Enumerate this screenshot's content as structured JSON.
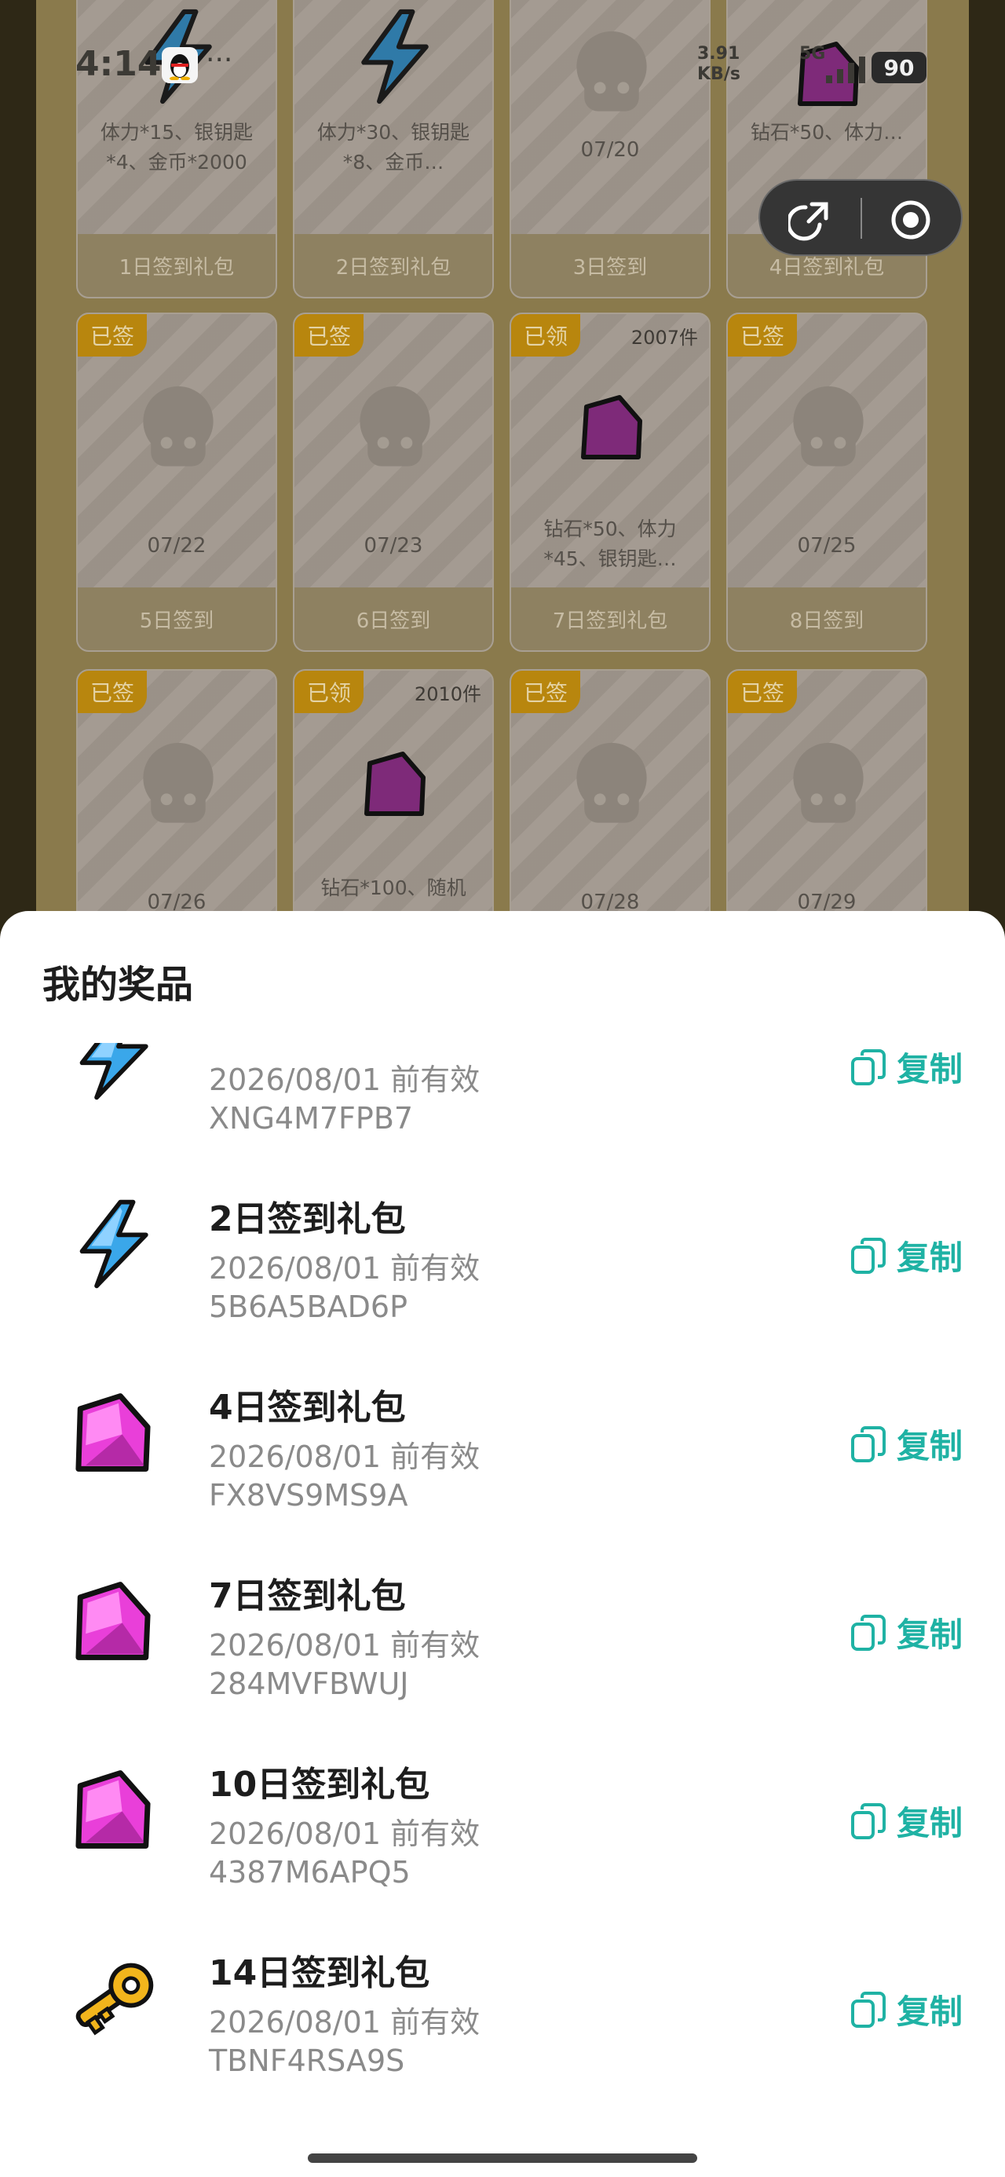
{
  "status_bar": {
    "time": "4:14",
    "dots": "···",
    "net_speed_value": "3.91",
    "net_speed_unit": "KB/s",
    "network_type": "5G",
    "battery": "90"
  },
  "background_cards": [
    {
      "desc": "体力*15、银钥匙*4、金币*2000",
      "footer": "1日签到礼包",
      "icon": "lightning-icon"
    },
    {
      "desc": "体力*30、银钥匙*8、金币…",
      "footer": "2日签到礼包",
      "icon": "lightning-icon"
    },
    {
      "date": "07/20",
      "footer": "3日签到",
      "icon": "mascot-placeholder-icon"
    },
    {
      "desc": "钻石*50、体力…",
      "footer": "4日签到礼包",
      "icon": "gem-icon"
    },
    {
      "badge": "已签",
      "date": "07/22",
      "footer": "5日签到",
      "icon": "mascot-placeholder-icon"
    },
    {
      "badge": "已签",
      "date": "07/23",
      "footer": "6日签到",
      "icon": "mascot-placeholder-icon"
    },
    {
      "badge": "已领",
      "count": "2007件",
      "desc": "钻石*50、体力*45、银钥匙…",
      "footer": "7日签到礼包",
      "icon": "gem-icon"
    },
    {
      "badge": "已签",
      "date": "07/25",
      "footer": "8日签到",
      "icon": "mascot-placeholder-icon"
    },
    {
      "badge": "已签",
      "date": "07/26",
      "icon": "mascot-placeholder-icon"
    },
    {
      "badge": "已领",
      "count": "2010件",
      "desc": "钻石*100、随机",
      "icon": "gem-icon"
    },
    {
      "badge": "已签",
      "date": "07/28",
      "icon": "mascot-placeholder-icon"
    },
    {
      "badge": "已签",
      "date": "07/29",
      "icon": "mascot-placeholder-icon"
    }
  ],
  "sheet": {
    "title": "我的奖品",
    "copy_label": "复制",
    "prizes": [
      {
        "name": "",
        "valid": "2026/08/01 前有效",
        "code": "XNG4M7FPB7",
        "icon": "lightning-icon"
      },
      {
        "name": "2日签到礼包",
        "valid": "2026/08/01 前有效",
        "code": "5B6A5BAD6P",
        "icon": "lightning-icon"
      },
      {
        "name": "4日签到礼包",
        "valid": "2026/08/01 前有效",
        "code": "FX8VS9MS9A",
        "icon": "gem-icon"
      },
      {
        "name": "7日签到礼包",
        "valid": "2026/08/01 前有效",
        "code": "284MVFBWUJ",
        "icon": "gem-icon"
      },
      {
        "name": "10日签到礼包",
        "valid": "2026/08/01 前有效",
        "code": "4387M6APQ5",
        "icon": "gem-icon"
      },
      {
        "name": "14日签到礼包",
        "valid": "2026/08/01 前有效",
        "code": "TBNF4RSA9S",
        "icon": "key-icon"
      }
    ]
  },
  "colors": {
    "accent": "#1fb2a4",
    "badge": "#b8860e",
    "gem": "#d633c8",
    "lightning": "#2f9fe0",
    "key": "#f2b51c"
  }
}
